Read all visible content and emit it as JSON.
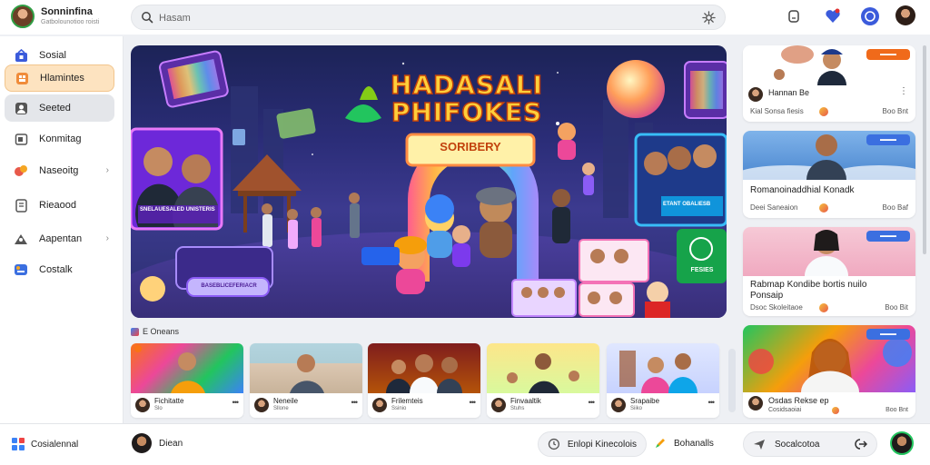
{
  "app": {
    "title": "Sonninfina",
    "subtitle": "Gatbolounotioo roisti"
  },
  "search": {
    "placeholder": "Hasam"
  },
  "sidebar": {
    "items": [
      {
        "label": "Sosial",
        "icon": "home-icon"
      },
      {
        "label": "Hlamintes",
        "icon": "grid-icon"
      },
      {
        "label": "Seeted",
        "icon": "person-icon"
      },
      {
        "label": "Konmitag",
        "icon": "tv-icon"
      },
      {
        "label": "Naseoitg",
        "icon": "bell-icon"
      },
      {
        "label": "Rieaood",
        "icon": "document-icon"
      },
      {
        "label": "Aapentan",
        "icon": "user-group-icon"
      },
      {
        "label": "Costalk",
        "icon": "chat-icon"
      }
    ]
  },
  "hero": {
    "title_line1": "HADASALI",
    "title_line2": "PHIFOKES",
    "sign": "SORIBERY",
    "screen_caption": "SNELAUESALED UNISTERIS",
    "screen_caption_2": "ETANT OBALIESB",
    "pill_caption": "BASEBLICEFERIACR",
    "green_label": "FESIES"
  },
  "rail": [
    {
      "title": "Hannan Be",
      "meta": "Kial Sonsa fiesis",
      "meta_right": "Boo Bnt",
      "badge_color": "#f06a1a"
    },
    {
      "title": "Romanoinaddhial Konadk",
      "meta": "Deei Saneaion",
      "meta_right": "Boo Baf",
      "badge_color": "#3b6fe0"
    },
    {
      "title": "Rabmap Kondibe bortis nuilo",
      "title2": "Ponsaip",
      "meta": "Dsoc Skoleitaoe",
      "meta_right": "Boo Bit",
      "badge_color": "#3b6fe0"
    },
    {
      "title": "Osdas Rekse ep",
      "meta": "Cosidsaoiai",
      "meta_right": "Boo Bnt",
      "badge_color": "#3b6fe0"
    }
  ],
  "shelf": {
    "header": "E Oneans",
    "cards": [
      {
        "title": "Fichitatte",
        "sub": "Slo"
      },
      {
        "title": "Neneile",
        "sub": "Sllone"
      },
      {
        "title": "Frilemteis",
        "sub": "Ssinio"
      },
      {
        "title": "Finvaaltik",
        "sub": "Stuhs"
      },
      {
        "title": "Srapaibe",
        "sub": "Siiko"
      }
    ]
  },
  "bottombar": {
    "left_label": "Cosialennal",
    "user_label": "Diean",
    "pill1": "Enlopi Kinecolois",
    "pill2": "Bohanalls",
    "pill3": "Socalcotoa"
  },
  "colors": {
    "accent_orange": "#f06a1a",
    "accent_blue": "#3b5bdb",
    "active_nav": "#fde3c0"
  }
}
